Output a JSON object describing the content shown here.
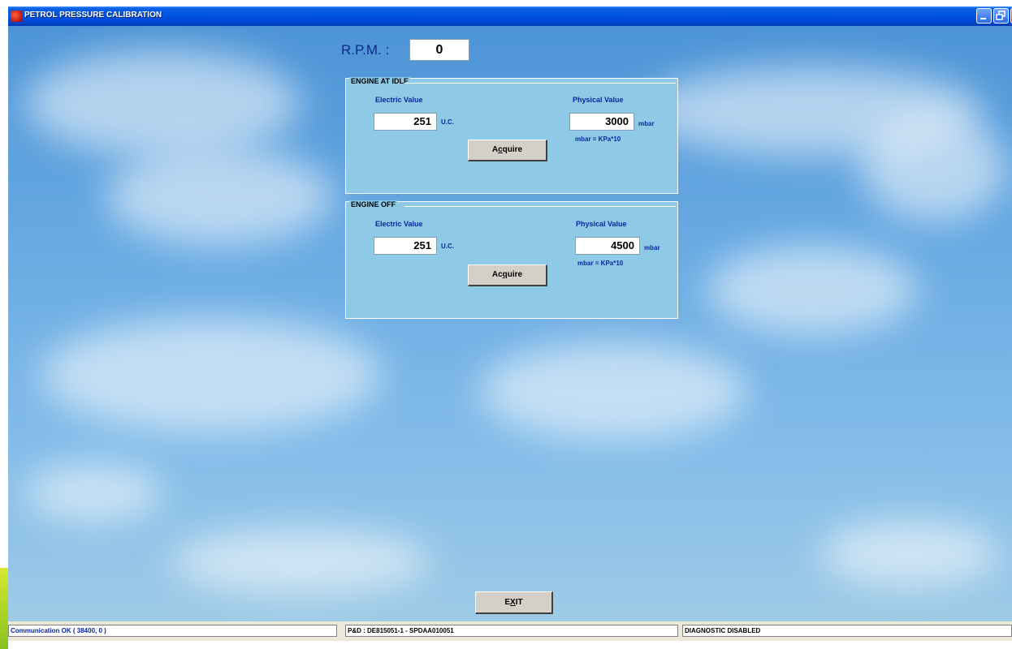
{
  "window": {
    "title": "PETROL PRESSURE CALIBRATION",
    "controls": [
      "minimize-icon",
      "restore-icon",
      "close-icon"
    ]
  },
  "rpm": {
    "label": "R.P.M. :",
    "value": "0"
  },
  "idle": {
    "title": "ENGINE AT IDLE",
    "electric_label": "Electric Value",
    "electric_value": "251",
    "electric_unit": "U.C.",
    "physical_label": "Physical Value",
    "physical_value": "3000",
    "physical_unit": "mbar",
    "note": "mbar = KPa*10",
    "acquire_pre": "A",
    "acquire_ul": "c",
    "acquire_post": "quire"
  },
  "off": {
    "title": "ENGINE OFF",
    "electric_label": "Electric Value",
    "electric_value": "251",
    "electric_unit": "U.C.",
    "physical_label": "Physical Value",
    "physical_value": "4500",
    "physical_unit": "mbar",
    "note": "mbar = KPa*10",
    "acquire_pre": "Ac",
    "acquire_ul": "q",
    "acquire_post": "uire"
  },
  "exit": {
    "pre": "E",
    "ul": "X",
    "post": "IT"
  },
  "status": {
    "communication": "Communication OK ( 38400,  0 )",
    "part": "P&D : DE815051-1 - SPDAA010051",
    "diagnostic": "DIAGNOSTIC DISABLED"
  },
  "colors": {
    "titlebar": "#0055e5",
    "panel": "#8ecae6",
    "label_blue": "#0b26a0",
    "sky": "#67a9e2"
  }
}
